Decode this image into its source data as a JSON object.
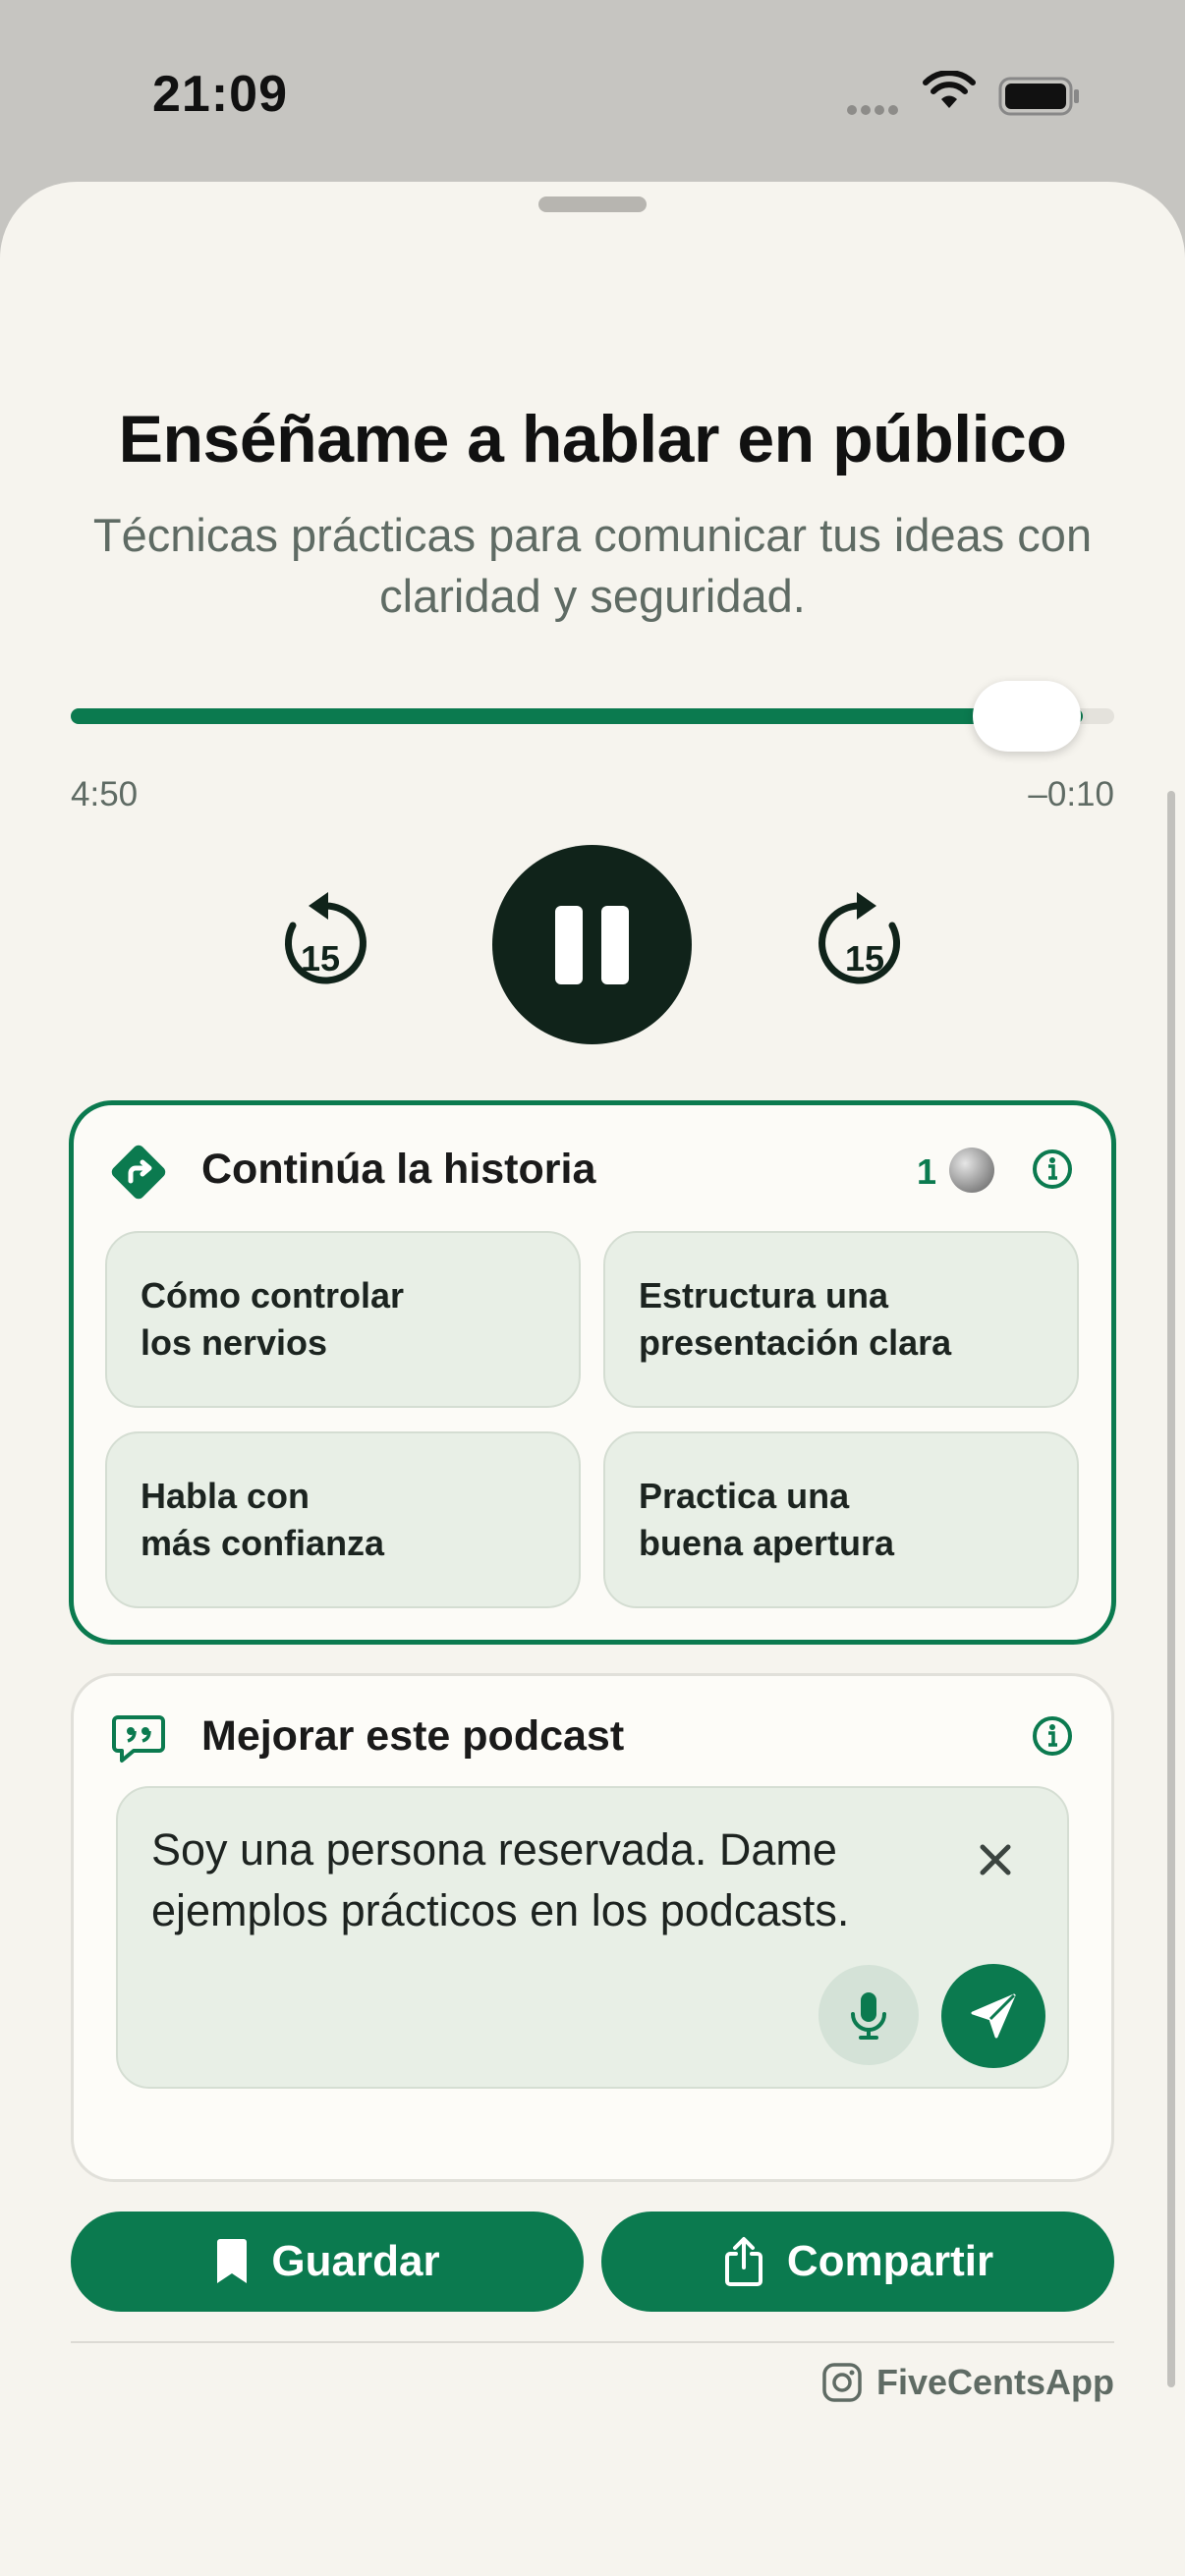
{
  "status_bar": {
    "time": "21:09"
  },
  "player": {
    "title": "Enséñame a hablar en público",
    "subtitle": "Técnicas prácticas para comunicar tus ideas con claridad y seguridad.",
    "progress_fraction": 0.97,
    "elapsed": "4:50",
    "remaining": "–0:10",
    "skip_back_seconds": "15",
    "skip_forward_seconds": "15"
  },
  "story": {
    "title": "Continúa la historia",
    "count": "1",
    "chips": [
      {
        "line1": "Cómo controlar",
        "line2": "los nervios"
      },
      {
        "line1": "Estructura una",
        "line2": "presentación clara"
      },
      {
        "line1": "Habla con",
        "line2": "más confianza"
      },
      {
        "line1": "Practica una",
        "line2": "buena apertura"
      }
    ]
  },
  "improve": {
    "title": "Mejorar este podcast",
    "input_value": "Soy una persona reservada. Dame ejemplos prácticos en los podcasts."
  },
  "actions": {
    "save_label": "Guardar",
    "share_label": "Compartir"
  },
  "footer": {
    "brand": "FiveCentsApp"
  },
  "colors": {
    "accent": "#0b7a4f",
    "background": "#f6f4ee",
    "chip": "#e8efe6",
    "dark": "#10231a"
  }
}
